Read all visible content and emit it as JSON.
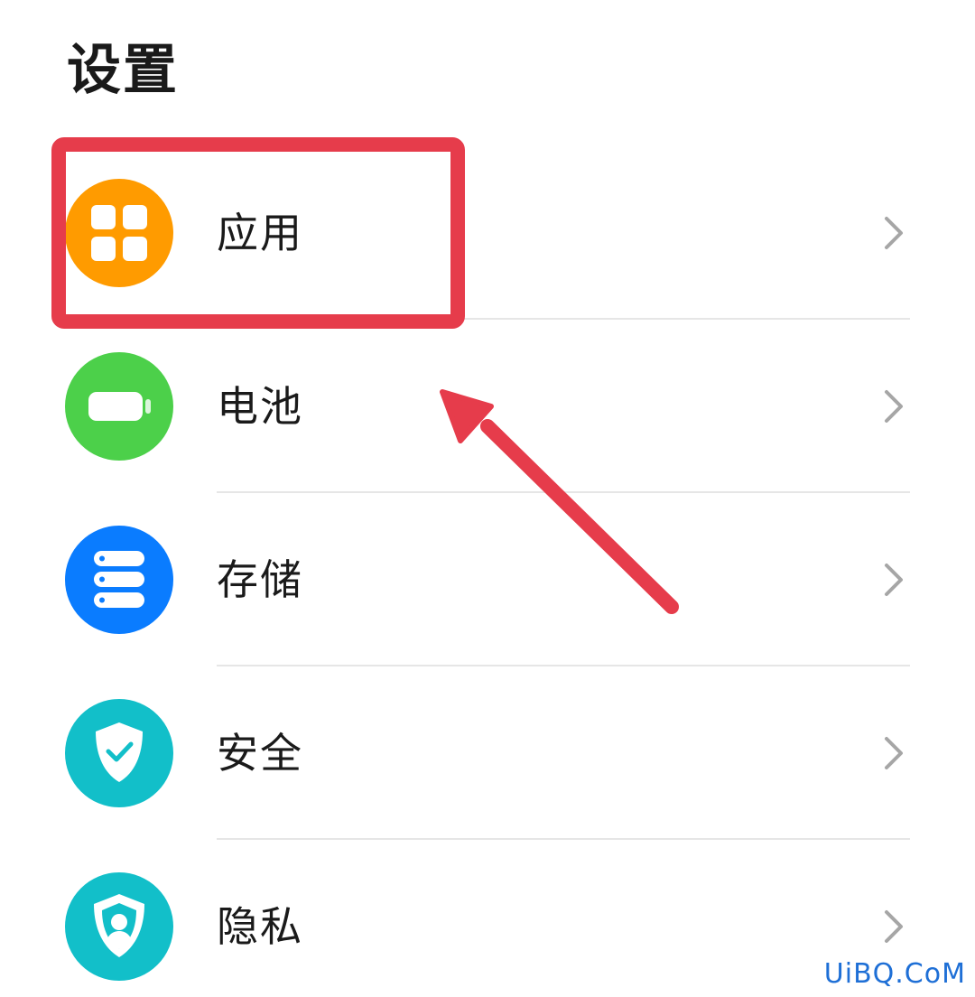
{
  "header": {
    "title": "设置"
  },
  "items": [
    {
      "label": "应用",
      "icon": "apps-grid-icon",
      "color": "#FF9B00"
    },
    {
      "label": "电池",
      "icon": "battery-icon",
      "color": "#4CD04A"
    },
    {
      "label": "存储",
      "icon": "storage-icon",
      "color": "#0A7CFF"
    },
    {
      "label": "安全",
      "icon": "shield-check-icon",
      "color": "#12BFC9"
    },
    {
      "label": "隐私",
      "icon": "privacy-shield-icon",
      "color": "#12BFC9"
    }
  ],
  "annotation": {
    "color": "#E63C4B"
  },
  "watermark": {
    "text": "UiBQ.CoM",
    "color": "#1E6FD6"
  }
}
